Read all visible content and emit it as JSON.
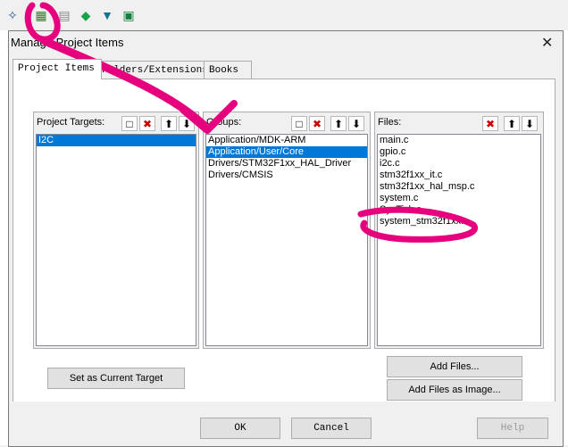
{
  "toolbar": {
    "icons": [
      "magic-wand-icon",
      "project-items-icon",
      "stack-icon",
      "diamond-icon",
      "download-icon",
      "package-icon"
    ]
  },
  "dialog": {
    "title": "Manage Project Items",
    "tabs": [
      {
        "label": "Project Items",
        "active": true
      },
      {
        "label": "Folders/Extensions",
        "active": false
      },
      {
        "label": "Books",
        "active": false
      }
    ]
  },
  "targets": {
    "label": "Project Targets:",
    "items": [
      "I2C"
    ],
    "selected": 0
  },
  "groups": {
    "label": "Groups:",
    "items": [
      "Application/MDK-ARM",
      "Application/User/Core",
      "Drivers/STM32F1xx_HAL_Driver",
      "Drivers/CMSIS"
    ],
    "selected": 1
  },
  "files": {
    "label": "Files:",
    "items": [
      "main.c",
      "gpio.c",
      "i2c.c",
      "stm32f1xx_it.c",
      "stm32f1xx_hal_msp.c",
      "system.c",
      "SysTick.c",
      "system_stm32f1xx.c"
    ]
  },
  "buttons": {
    "set_target": "Set as Current Target",
    "add_files": "Add Files...",
    "add_files_image": "Add Files as Image...",
    "ok": "OK",
    "cancel": "Cancel",
    "help": "Help"
  },
  "colors": {
    "selection": "#0078d7",
    "annotation": "#e6007e"
  }
}
